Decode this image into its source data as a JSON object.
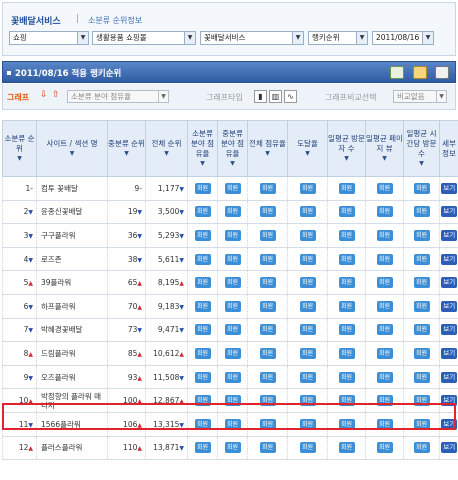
{
  "header": {
    "title": "꽃배달서비스",
    "separator": "|",
    "subtitle": "소분류 순위정보"
  },
  "filters": {
    "category1": "쇼핑",
    "category2": "생활용품 쇼핑몰",
    "category3": "꽃배달서비스",
    "metric": "랭키순위",
    "date": "2011/08/16"
  },
  "panel": {
    "title": "2011/08/16 적용 랭키순위"
  },
  "graph": {
    "label": "그래프",
    "select_placeholder": "소분류 분야 점유율",
    "type_label": "그래프타입",
    "compare_label": "그래프비교선택",
    "compare_value": "비교없음"
  },
  "table": {
    "headers": {
      "subrank": "소분류 순위",
      "site": "사이트 / 섹션 명",
      "midrank": "중분류 순위",
      "totalrank": "전체 순위",
      "sub_share": "소분류 분야 점유율",
      "mid_share": "중분류 분야 점유율",
      "total_share": "전체 점유율",
      "reach": "도달율",
      "daily_visitors": "일평균 방문자 수",
      "daily_pageviews": "일평균 페이지 뷰",
      "daily_time": "일평균 시간당 방문수",
      "detail": "세부 정보"
    },
    "member_label": "회원",
    "view_label": "보기",
    "rows": [
      {
        "subrank": "1",
        "site": "컴투 꽃배달",
        "midrank": "9",
        "totalrank": "1,177"
      },
      {
        "subrank": "2",
        "site": "윤종신꽃배달",
        "midrank": "19",
        "totalrank": "3,500"
      },
      {
        "subrank": "3",
        "site": "구구플라워",
        "midrank": "36",
        "totalrank": "5,293"
      },
      {
        "subrank": "4",
        "site": "로즈존",
        "midrank": "38",
        "totalrank": "5,611"
      },
      {
        "subrank": "5",
        "site": "39플라워",
        "midrank": "65",
        "totalrank": "8,195"
      },
      {
        "subrank": "6",
        "site": "하프플라워",
        "midrank": "70",
        "totalrank": "9,183"
      },
      {
        "subrank": "7",
        "site": "박혜경꽃배달",
        "midrank": "73",
        "totalrank": "9,471"
      },
      {
        "subrank": "8",
        "site": "드림플라워",
        "midrank": "85",
        "totalrank": "10,612"
      },
      {
        "subrank": "9",
        "site": "오즈플라워",
        "midrank": "93",
        "totalrank": "11,508"
      },
      {
        "subrank": "10",
        "site": "박정향의 플라워 매니저",
        "midrank": "100",
        "totalrank": "12,867"
      },
      {
        "subrank": "11",
        "site": "1566플라워",
        "midrank": "106",
        "totalrank": "13,315"
      },
      {
        "subrank": "12",
        "site": "플러스플라워",
        "midrank": "110",
        "totalrank": "13,871"
      }
    ]
  }
}
